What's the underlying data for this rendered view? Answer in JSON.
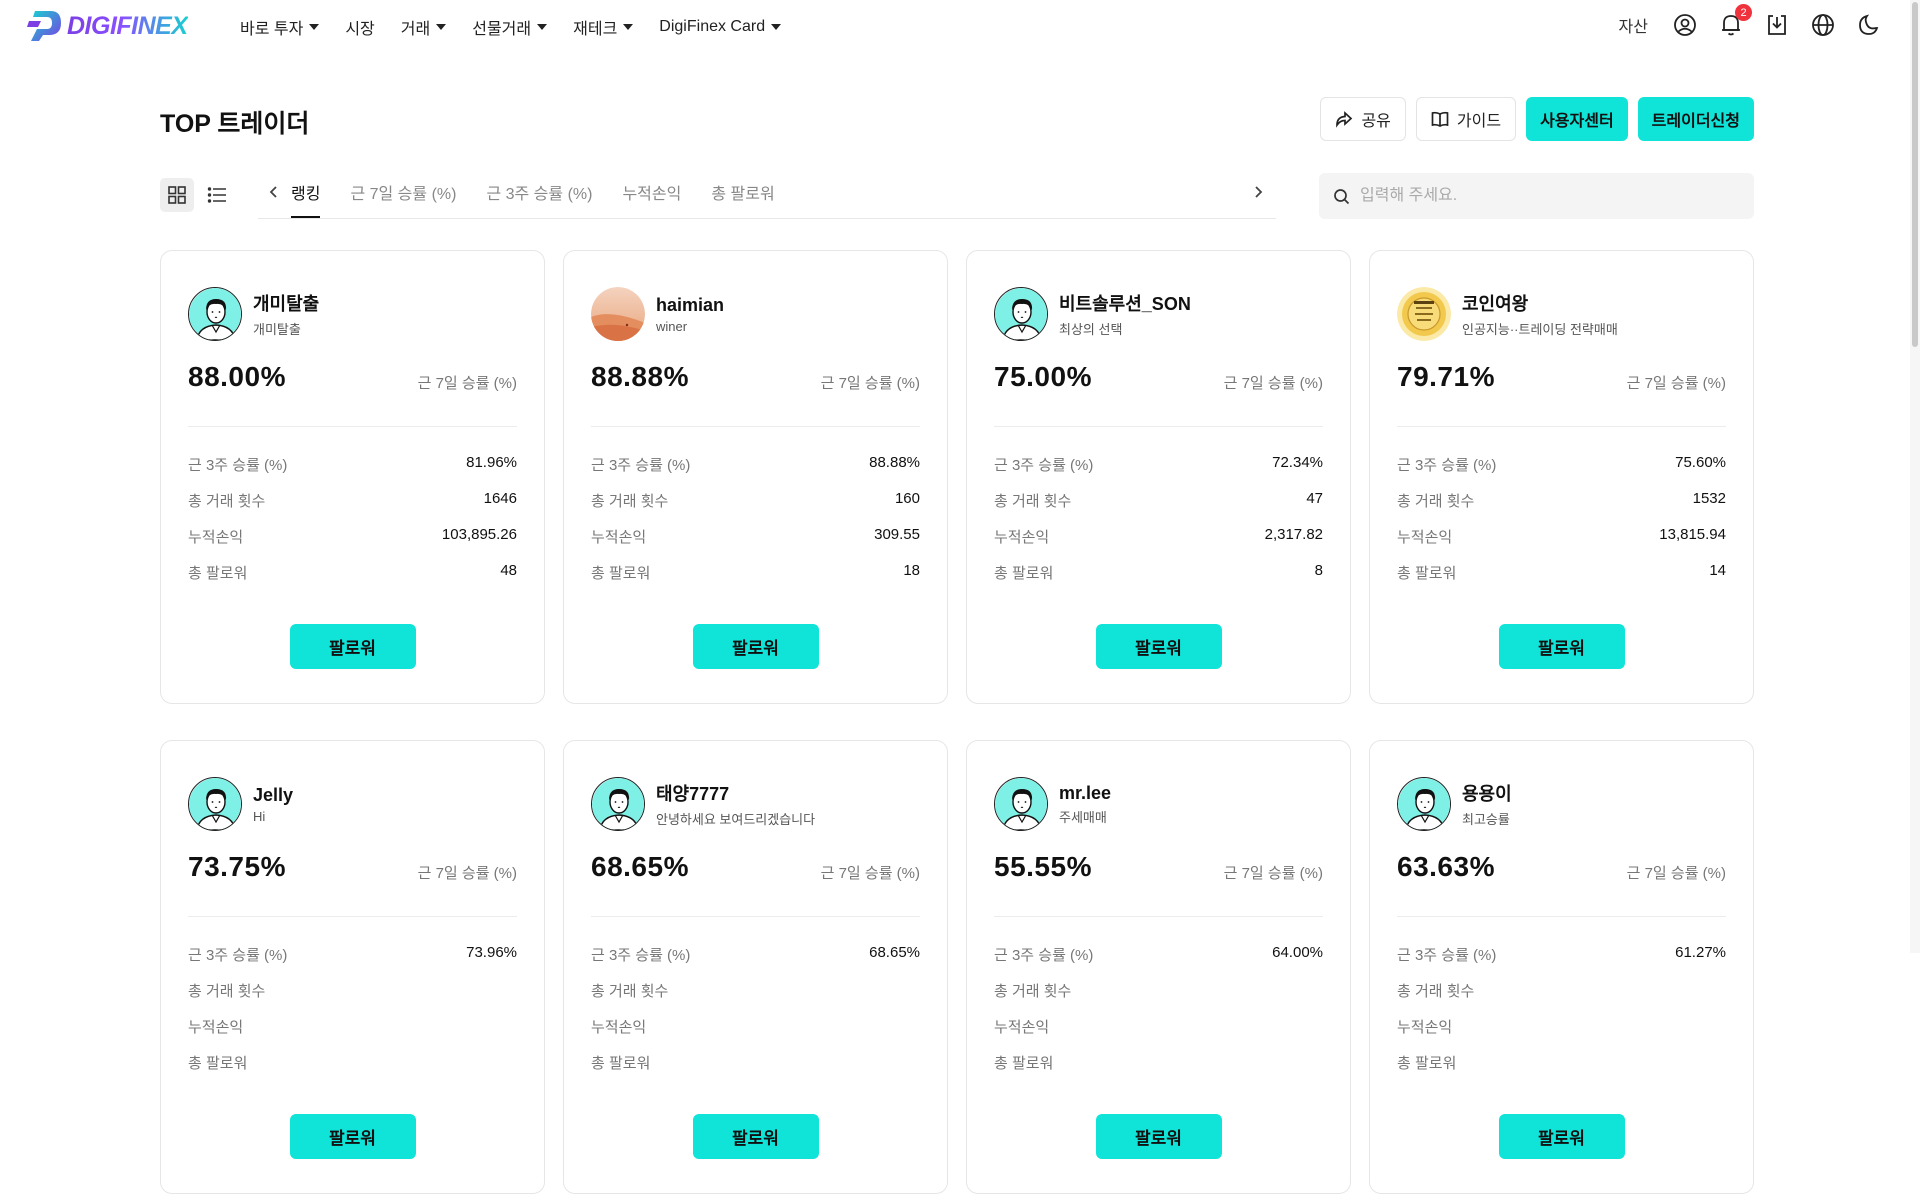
{
  "brand": {
    "name": "DIGIFINEX"
  },
  "nav": [
    {
      "label": "바로 투자",
      "dropdown": true
    },
    {
      "label": "시장",
      "dropdown": false
    },
    {
      "label": "거래",
      "dropdown": true
    },
    {
      "label": "선물거래",
      "dropdown": true
    },
    {
      "label": "재테크",
      "dropdown": true
    },
    {
      "label": "DigiFinex Card",
      "dropdown": true
    }
  ],
  "topbar": {
    "asset_label": "자산",
    "notification_count": "2",
    "icons": [
      "user-icon",
      "bell-icon",
      "download-icon",
      "globe-icon",
      "moon-icon"
    ]
  },
  "header": {
    "title": "TOP 트레이더"
  },
  "actions": {
    "share": "공유",
    "guide": "가이드",
    "user_center": "사용자센터",
    "apply_trader": "트레이더신청"
  },
  "tabs": [
    {
      "label": "랭킹",
      "active": true
    },
    {
      "label": "근 7일 승률 (%)",
      "active": false
    },
    {
      "label": "근 3주 승률 (%)",
      "active": false
    },
    {
      "label": "누적손익",
      "active": false
    },
    {
      "label": "총 팔로워",
      "active": false
    }
  ],
  "search": {
    "placeholder": "입력해 주세요.",
    "value": ""
  },
  "card_labels": {
    "rate_label": "근 7일 승률 (%)",
    "three_week": "근 3주 승률 (%)",
    "total_trades": "총 거래 횟수",
    "cum_pnl": "누적손익",
    "followers": "총 팔로워",
    "follow_button": "팔로워"
  },
  "traders": [
    {
      "name": "개미탈출",
      "sub": "개미탈출",
      "rate": "88.00%",
      "three_week": "81.96%",
      "total_trades": "1646",
      "cum_pnl": "103,895.26",
      "followers": "48",
      "avatar": "default"
    },
    {
      "name": "haimian",
      "sub": "winer",
      "rate": "88.88%",
      "three_week": "88.88%",
      "total_trades": "160",
      "cum_pnl": "309.55",
      "followers": "18",
      "avatar": "photo-desert"
    },
    {
      "name": "비트솔루션_SON",
      "sub": "최상의 선택",
      "rate": "75.00%",
      "three_week": "72.34%",
      "total_trades": "47",
      "cum_pnl": "2,317.82",
      "followers": "8",
      "avatar": "default"
    },
    {
      "name": "코인여왕",
      "sub": "인공지능··트레이딩 전략매매",
      "rate": "79.71%",
      "three_week": "75.60%",
      "total_trades": "1532",
      "cum_pnl": "13,815.94",
      "followers": "14",
      "avatar": "photo-coin"
    },
    {
      "name": "Jelly",
      "sub": "Hi",
      "rate": "73.75%",
      "three_week": "73.96%",
      "total_trades": "",
      "cum_pnl": "",
      "followers": "",
      "avatar": "default"
    },
    {
      "name": "태양7777",
      "sub": "안녕하세요 보여드리겠습니다",
      "rate": "68.65%",
      "three_week": "68.65%",
      "total_trades": "",
      "cum_pnl": "",
      "followers": "",
      "avatar": "default"
    },
    {
      "name": "mr.lee",
      "sub": "주세매매",
      "rate": "55.55%",
      "three_week": "64.00%",
      "total_trades": "",
      "cum_pnl": "",
      "followers": "",
      "avatar": "default"
    },
    {
      "name": "용용이",
      "sub": "최고승률",
      "rate": "63.63%",
      "three_week": "61.27%",
      "total_trades": "",
      "cum_pnl": "",
      "followers": "",
      "avatar": "default"
    }
  ],
  "colors": {
    "accent": "#10e4d8",
    "badge": "#f0323c",
    "brand_purple": "#7b3fe4",
    "brand_teal": "#16d1cf",
    "avatar_bg": "#7ff0e6"
  }
}
